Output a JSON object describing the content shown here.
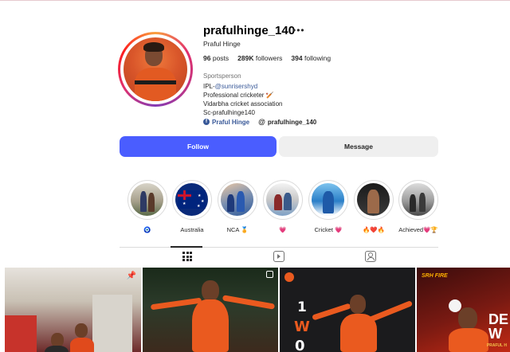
{
  "profile": {
    "username": "prafulhinge_140",
    "full_name": "Praful Hinge",
    "stats": {
      "posts_count": "96",
      "posts_label": "posts",
      "followers_count": "289K",
      "followers_label": "followers",
      "following_count": "394",
      "following_label": "following"
    },
    "category": "Sportsperson",
    "bio": {
      "line1_prefix": "IPL-",
      "line1_tag": "@sunrisershyd",
      "line2": "Professional cricketer 🏏",
      "line3": "Vidarbha cricket association",
      "line4": "Sc-prafulhinge140"
    },
    "links": {
      "facebook": "Praful Hinge",
      "threads": "prafulhinge_140"
    }
  },
  "actions": {
    "follow_label": "Follow",
    "message_label": "Message"
  },
  "highlights": [
    {
      "label": "🧿",
      "icon": "highlight-photo"
    },
    {
      "label": "Australia",
      "icon": "australia-flag"
    },
    {
      "label": "NCA 🏅",
      "icon": "highlight-photo"
    },
    {
      "label": "💗",
      "icon": "highlight-photo"
    },
    {
      "label": "Cricket 💗",
      "icon": "highlight-photo"
    },
    {
      "label": "🔥❤️🔥",
      "icon": "highlight-photo"
    },
    {
      "label": "Achieved💗🏆",
      "icon": "highlight-photo"
    }
  ],
  "tabs": [
    {
      "name": "posts",
      "icon": "grid-icon",
      "active": true
    },
    {
      "name": "reels",
      "icon": "reels-icon",
      "active": false
    },
    {
      "name": "tagged",
      "icon": "tagged-icon",
      "active": false
    }
  ],
  "posts_preview": {
    "post3_text_1": "1",
    "post3_text_2": "W",
    "post3_text_3": "0",
    "post4_badge": "SRH FIRE",
    "post4_big": "DE",
    "post4_big2": "W",
    "post4_caption": "PRAFUL H"
  },
  "colors": {
    "follow_button": "#4a5dff",
    "message_button": "#efefef",
    "link_blue": "#385898",
    "srh_orange": "#ea5a1f"
  }
}
